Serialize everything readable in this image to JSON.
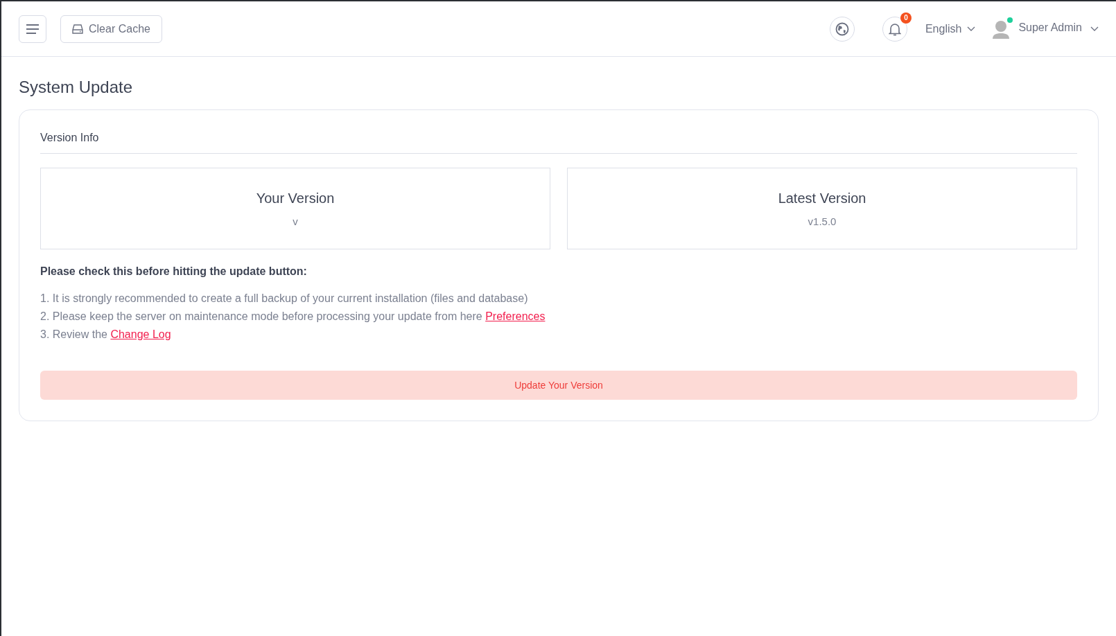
{
  "header": {
    "clear_cache": "Clear Cache",
    "language": "English",
    "notifications": {
      "count": "0"
    },
    "user": {
      "name": "Super Admin",
      "online": true
    }
  },
  "page_title": "System Update",
  "card": {
    "title": "Version Info",
    "versions": [
      {
        "label": "Your Version",
        "value": "v"
      },
      {
        "label": "Latest Version",
        "value": "v1.5.0"
      }
    ],
    "notice_title": "Please check this before hitting the update button:",
    "steps": [
      {
        "number": "1.",
        "text": "It is strongly recommended to create a full backup of your current installation (files and database)"
      },
      {
        "number": "2.",
        "text": "Please keep the server on maintenance mode before processing your update from here",
        "link": "Preferences"
      },
      {
        "number": "3.",
        "text": "Review the",
        "link": "Change Log"
      }
    ],
    "update_button": "Update Your Version"
  }
}
